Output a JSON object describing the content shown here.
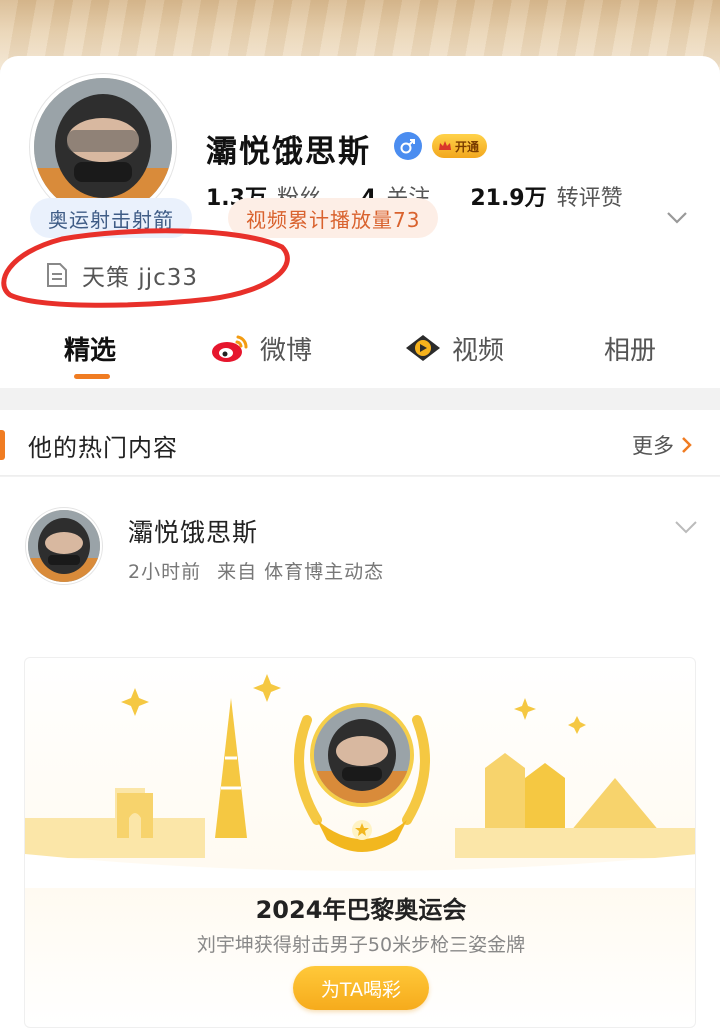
{
  "profile": {
    "username": "灞悦饿思斯",
    "gender": "male",
    "vip_label": "开通",
    "stats": [
      {
        "num": "1.3万",
        "label": "粉丝"
      },
      {
        "num": "4",
        "label": "关注"
      },
      {
        "num": "21.9万",
        "label": "转评赞"
      }
    ],
    "tags": [
      "奥运射击射箭",
      "视频累计播放量73"
    ],
    "bio": "天策 jjc33"
  },
  "tabs": [
    {
      "label": "精选",
      "active": true
    },
    {
      "label": "微博",
      "icon": "weibo-icon"
    },
    {
      "label": "视频",
      "icon": "video-icon"
    },
    {
      "label": "相册"
    }
  ],
  "hot_section": {
    "title": "他的热门内容",
    "more": "更多"
  },
  "post": {
    "author": "灞悦饿思斯",
    "time": "2小时前",
    "source": "来自 体育博主动态"
  },
  "olympic_card": {
    "title": "2024年巴黎奥运会",
    "subtitle": "刘宇坤获得射击男子50米步枪三姿金牌",
    "button": "为TA喝彩"
  },
  "colors": {
    "accent": "#f07c22",
    "annotation": "#e8302a",
    "gold": "#f6c53a"
  }
}
